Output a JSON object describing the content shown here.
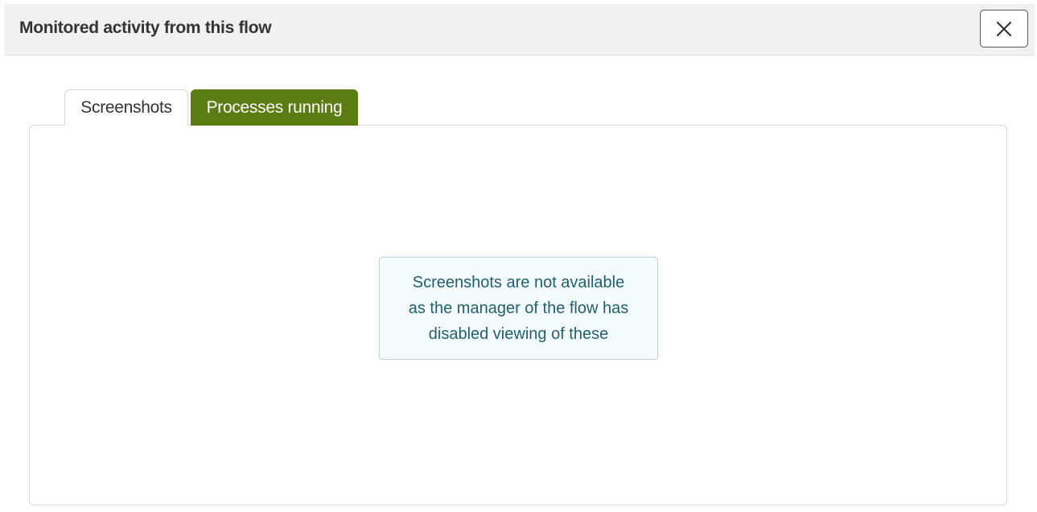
{
  "modal": {
    "title": "Monitored activity from this flow",
    "close_icon": "close-icon"
  },
  "tabs": [
    {
      "label": "Screenshots",
      "active": true
    },
    {
      "label": "Processes running",
      "active": false
    }
  ],
  "panel": {
    "message_line1": "Screenshots are not available",
    "message_line2": "as the manager of the flow has",
    "message_line3": "disabled viewing of these"
  },
  "colors": {
    "header_bg": "#f1f1f1",
    "accent_green": "#5b7c12",
    "info_text": "#215f6f",
    "info_bg": "#f5fcfd",
    "info_border": "#b9d6dd"
  }
}
